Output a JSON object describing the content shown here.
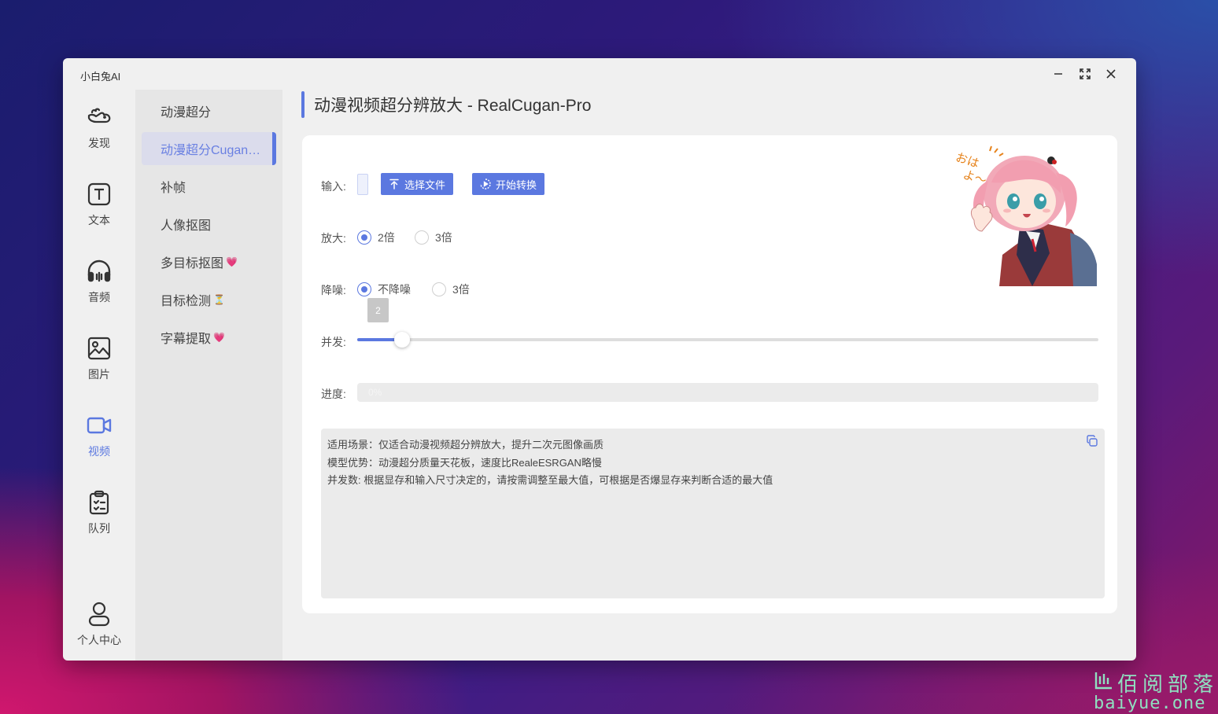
{
  "app": {
    "title": "小白兔AI"
  },
  "window_controls": {
    "minimize": "minimize-icon",
    "maximize": "maximize-icon",
    "close": "close-icon"
  },
  "rail": {
    "items": [
      {
        "label": "发现",
        "icon": "rabbit-icon"
      },
      {
        "label": "文本",
        "icon": "text-icon"
      },
      {
        "label": "音频",
        "icon": "headphones-icon"
      },
      {
        "label": "图片",
        "icon": "image-icon"
      },
      {
        "label": "视频",
        "icon": "video-icon",
        "active": true
      },
      {
        "label": "队列",
        "icon": "clipboard-icon"
      }
    ],
    "profile": {
      "label": "个人中心",
      "icon": "user-icon"
    }
  },
  "submenu": {
    "items": [
      {
        "label": "动漫超分"
      },
      {
        "label": "动漫超分Cugan-Pro",
        "active": true
      },
      {
        "label": "补帧"
      },
      {
        "label": "人像抠图"
      },
      {
        "label": "多目标抠图",
        "badge": "💗"
      },
      {
        "label": "目标检测",
        "badge": "⏳"
      },
      {
        "label": "字幕提取",
        "badge": "💗"
      }
    ]
  },
  "page": {
    "title": "动漫视频超分辨放大 - RealCugan-Pro"
  },
  "form": {
    "input_label": "输入:",
    "select_file_button": "选择文件",
    "start_button": "开始转换",
    "scale_label": "放大:",
    "scale_options": [
      "2倍",
      "3倍"
    ],
    "scale_selected": "2倍",
    "denoise_label": "降噪:",
    "denoise_options": [
      "不降噪",
      "3倍"
    ],
    "denoise_selected": "不降噪",
    "concurrency_label": "并发:",
    "concurrency_value": "2",
    "concurrency_fraction": 0.06,
    "progress_label": "进度:",
    "progress_text": "0%",
    "progress_fraction": 0.0
  },
  "info": {
    "lines": [
      "适用场景：仅适合动漫视频超分辨放大，提升二次元图像画质",
      "模型优势：动漫超分质量天花板，速度比RealeESRGAN略慢",
      "并发数: 根据显存和输入尺寸决定的，请按需调整至最大值，可根据是否爆显存来判断合适的最大值"
    ],
    "copy_icon": "copy-icon"
  },
  "mascot": {
    "caption": "おはよ〜！"
  },
  "watermark": {
    "zh": "佰阅部落",
    "en": "baiyue.one"
  },
  "colors": {
    "accent": "#5b78e0",
    "window_bg": "#f0f0f0",
    "submenu_bg": "#e6e6e6"
  }
}
